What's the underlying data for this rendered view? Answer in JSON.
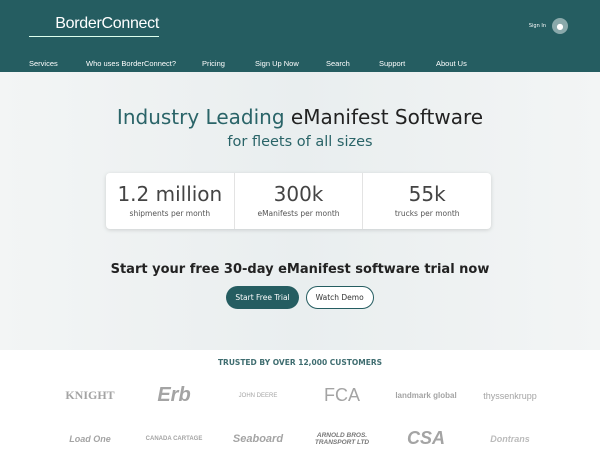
{
  "header": {
    "logo": "BorderConnect",
    "sign_in": "Sign In",
    "avatar_icon": "user-icon",
    "nav": [
      "Services",
      "Who uses BorderConnect?",
      "Pricing",
      "Sign Up Now",
      "Search",
      "Support",
      "About Us"
    ]
  },
  "hero": {
    "title_accent": "Industry Leading",
    "title_rest": " eManifest Software",
    "subtitle": "for fleets of all sizes",
    "stats": [
      {
        "value": "1.2 million",
        "label": "shipments per month"
      },
      {
        "value": "300k",
        "label": "eManifests per month"
      },
      {
        "value": "55k",
        "label": "trucks per month"
      }
    ],
    "cta": "Start your free 30-day eManifest software trial now",
    "primary_button": "Start Free Trial",
    "secondary_button": "Watch Demo"
  },
  "customers": {
    "heading": "TRUSTED BY OVER 12,000 CUSTOMERS",
    "row1": [
      "KNIGHT",
      "Erb",
      "JOHN DEERE",
      "FCA",
      "landmark global",
      "thyssenkrupp"
    ],
    "row2": [
      "Load One",
      "CANADA CARTAGE",
      "Seaboard",
      "ARNOLD BROS. TRANSPORT LTD",
      "CSA",
      "Dontrans"
    ]
  },
  "colors": {
    "brand": "#255d61"
  }
}
